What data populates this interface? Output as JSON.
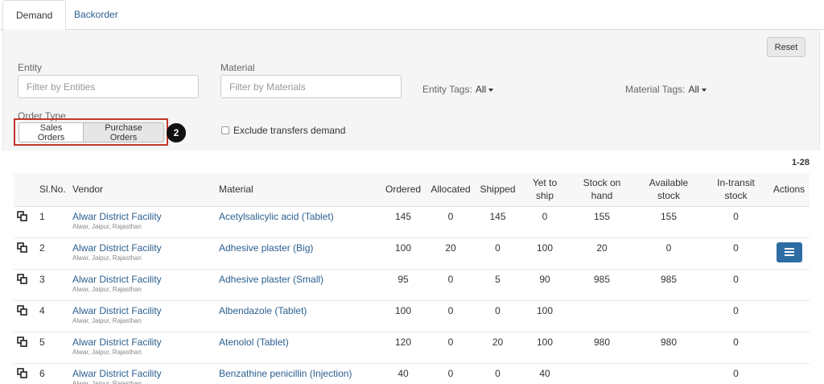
{
  "tabs": [
    {
      "label": "Demand"
    },
    {
      "label": "Backorder"
    }
  ],
  "filters": {
    "entity_label": "Entity",
    "entity_placeholder": "Filter by Entities",
    "material_label": "Material",
    "material_placeholder": "Filter by Materials",
    "entity_tags_label": "Entity Tags:",
    "entity_tags_value": "All",
    "material_tags_label": "Material Tags:",
    "material_tags_value": "All",
    "reset_label": "Reset",
    "order_type_label": "Order Type",
    "sales_orders_label": "Sales Orders",
    "purchase_orders_label": "Purchase Orders",
    "step_badge": "2",
    "exclude_transfers_label": "Exclude transfers demand"
  },
  "table": {
    "count": "1-28",
    "headers": {
      "slno": "Sl.No.",
      "vendor": "Vendor",
      "material": "Material",
      "ordered": "Ordered",
      "allocated": "Allocated",
      "shipped": "Shipped",
      "yet_to_ship_1": "Yet to",
      "yet_to_ship_2": "ship",
      "stock_on_hand_1": "Stock on",
      "stock_on_hand_2": "hand",
      "available_stock_1": "Available",
      "available_stock_2": "stock",
      "in_transit_1": "In-transit",
      "in_transit_2": "stock",
      "actions": "Actions"
    },
    "rows": [
      {
        "slno": "1",
        "vendor": "Alwar District Facility",
        "address": "Alwar, Jaipur, Rajasthan",
        "material": "Acetylsalicylic acid (Tablet)",
        "ordered": "145",
        "allocated": "0",
        "shipped": "145",
        "yet_to_ship": "0",
        "stock_on_hand": "155",
        "available_stock": "155",
        "in_transit": "0"
      },
      {
        "slno": "2",
        "vendor": "Alwar District Facility",
        "address": "Alwar, Jaipur, Rajasthan",
        "material": "Adhesive plaster (Big)",
        "ordered": "100",
        "allocated": "20",
        "shipped": "0",
        "yet_to_ship": "100",
        "stock_on_hand": "20",
        "available_stock": "0",
        "in_transit": "0"
      },
      {
        "slno": "3",
        "vendor": "Alwar District Facility",
        "address": "Alwar, Jaipur, Rajasthan",
        "material": "Adhesive plaster (Small)",
        "ordered": "95",
        "allocated": "0",
        "shipped": "5",
        "yet_to_ship": "90",
        "stock_on_hand": "985",
        "available_stock": "985",
        "in_transit": "0"
      },
      {
        "slno": "4",
        "vendor": "Alwar District Facility",
        "address": "Alwar, Jaipur, Rajasthan",
        "material": "Albendazole (Tablet)",
        "ordered": "100",
        "allocated": "0",
        "shipped": "0",
        "yet_to_ship": "100",
        "stock_on_hand": "",
        "available_stock": "",
        "in_transit": "0"
      },
      {
        "slno": "5",
        "vendor": "Alwar District Facility",
        "address": "Alwar, Jaipur, Rajasthan",
        "material": "Atenolol (Tablet)",
        "ordered": "120",
        "allocated": "0",
        "shipped": "20",
        "yet_to_ship": "100",
        "stock_on_hand": "980",
        "available_stock": "980",
        "in_transit": "0"
      },
      {
        "slno": "6",
        "vendor": "Alwar District Facility",
        "address": "Alwar, Jaipur, Rajasthan",
        "material": "Benzathine penicillin (Injection)",
        "ordered": "40",
        "allocated": "0",
        "shipped": "0",
        "yet_to_ship": "40",
        "stock_on_hand": "",
        "available_stock": "",
        "in_transit": "0"
      }
    ]
  }
}
